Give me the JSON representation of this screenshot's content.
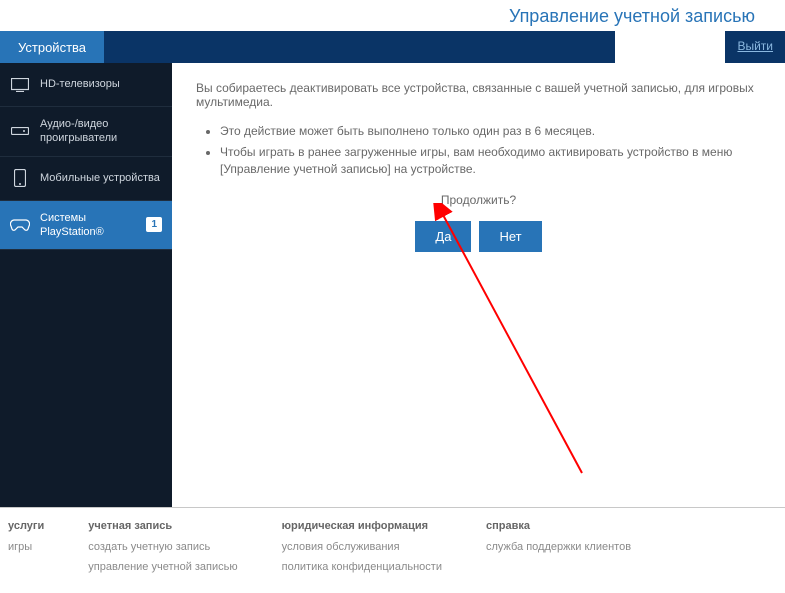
{
  "header": {
    "title": "Управление учетной записью"
  },
  "topbar": {
    "tab": "Устройства",
    "logout": "Выйти"
  },
  "sidebar": {
    "items": [
      {
        "label": "HD-телевизоры",
        "icon": "tv-icon"
      },
      {
        "label": "Аудио-/видео проигрыватели",
        "icon": "player-icon"
      },
      {
        "label": "Мобильные устройства",
        "icon": "mobile-icon"
      },
      {
        "label": "Системы PlayStation®",
        "icon": "controller-icon",
        "badge": "1"
      }
    ]
  },
  "content": {
    "message": "Вы собираетесь деактивировать все устройства, связанные с вашей учетной записью, для игровых мультимедиа.",
    "bullets": [
      "Это действие может быть выполнено только один раз в 6 месяцев.",
      "Чтобы играть в ранее загруженные игры, вам необходимо активировать устройство в меню [Управление учетной записью] на устройстве."
    ],
    "prompt": "Продолжить?",
    "yes": "Да",
    "no": "Нет"
  },
  "footer": {
    "cols": [
      {
        "heading": "услуги",
        "links": [
          "игры"
        ]
      },
      {
        "heading": "учетная запись",
        "links": [
          "создать учетную запись",
          "управление учетной записью"
        ]
      },
      {
        "heading": "юридическая информация",
        "links": [
          "условия обслуживания",
          "политика конфиденциальности"
        ]
      },
      {
        "heading": "справка",
        "links": [
          "служба поддержки клиентов"
        ]
      }
    ]
  }
}
